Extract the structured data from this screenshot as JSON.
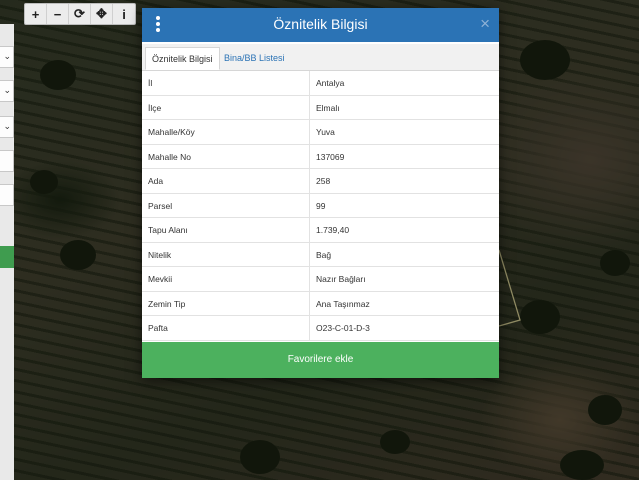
{
  "toolbar": {
    "zoom_in": "+",
    "zoom_out": "−",
    "refresh": "⟳",
    "locate": "✥",
    "info": "i"
  },
  "modal": {
    "title": "Öznitelik Bilgisi",
    "close": "×",
    "tabs": [
      {
        "label": "Öznitelik Bilgisi",
        "active": true
      },
      {
        "label": "Bina/BB Listesi",
        "active": false
      }
    ],
    "rows": [
      {
        "key": "İl",
        "value": "Antalya"
      },
      {
        "key": "İlçe",
        "value": "Elmalı"
      },
      {
        "key": "Mahalle/Köy",
        "value": "Yuva"
      },
      {
        "key": "Mahalle No",
        "value": "137069"
      },
      {
        "key": "Ada",
        "value": "258"
      },
      {
        "key": "Parsel",
        "value": "99"
      },
      {
        "key": "Tapu Alanı",
        "value": "1.739,40"
      },
      {
        "key": "Nitelik",
        "value": "Bağ"
      },
      {
        "key": "Mevkii",
        "value": "Nazır Bağları"
      },
      {
        "key": "Zemin Tip",
        "value": "Ana Taşınmaz"
      },
      {
        "key": "Pafta",
        "value": "O23-C-01-D-3"
      }
    ],
    "favorite_button": "Favorilere ekle"
  },
  "colors": {
    "header": "#2b73b5",
    "favorite_button": "#4cb15e",
    "parcel_outline": "#e8e0a0"
  },
  "icons": {
    "menu": "vertical-dots-icon",
    "close": "close-icon"
  }
}
